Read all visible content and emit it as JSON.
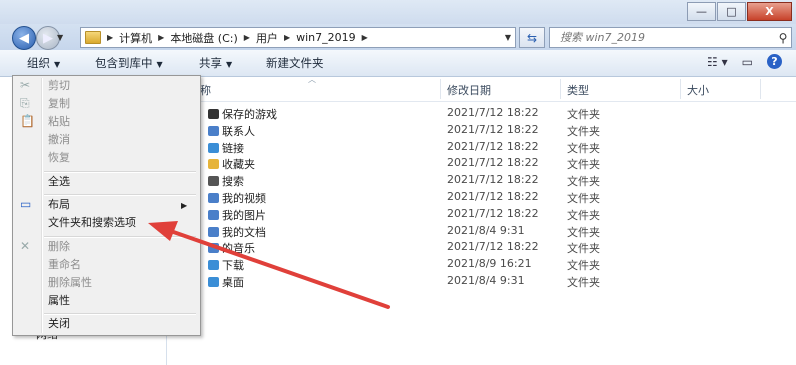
{
  "window": {
    "min": "—",
    "max": "□",
    "close": "X"
  },
  "address": {
    "crumbs": [
      "计算机",
      "本地磁盘 (C:)",
      "用户",
      "win7_2019"
    ]
  },
  "search": {
    "placeholder": "搜索 win7_2019"
  },
  "toolbar": {
    "organize": "组织",
    "include_library": "包含到库中",
    "share": "共享",
    "new_folder": "新建文件夹"
  },
  "columns": {
    "name": "称",
    "date": "修改日期",
    "type": "类型",
    "size": "大小"
  },
  "files": [
    {
      "name": "保存的游戏",
      "date": "2021/7/12 18:22",
      "type": "文件夹"
    },
    {
      "name": "联系人",
      "date": "2021/7/12 18:22",
      "type": "文件夹"
    },
    {
      "name": "链接",
      "date": "2021/7/12 18:22",
      "type": "文件夹"
    },
    {
      "name": "收藏夹",
      "date": "2021/7/12 18:22",
      "type": "文件夹"
    },
    {
      "name": "搜索",
      "date": "2021/7/12 18:22",
      "type": "文件夹"
    },
    {
      "name": "我的视频",
      "date": "2021/7/12 18:22",
      "type": "文件夹"
    },
    {
      "name": "我的图片",
      "date": "2021/7/12 18:22",
      "type": "文件夹"
    },
    {
      "name": "我的文档",
      "date": "2021/8/4 9:31",
      "type": "文件夹"
    },
    {
      "name": "的音乐",
      "date": "2021/7/12 18:22",
      "type": "文件夹"
    },
    {
      "name": "下载",
      "date": "2021/8/9 16:21",
      "type": "文件夹"
    },
    {
      "name": "桌面",
      "date": "2021/8/4 9:31",
      "type": "文件夹"
    }
  ],
  "menu": {
    "cut": "剪切",
    "copy": "复制",
    "paste": "粘贴",
    "undo": "撤消",
    "redo": "恢复",
    "select_all": "全选",
    "layout": "布局",
    "folder_options": "文件夹和搜索选项",
    "delete": "删除",
    "rename": "重命名",
    "remove_properties": "删除属性",
    "properties": "属性",
    "close": "关闭"
  },
  "sidebar": {
    "network": "网络"
  },
  "colors": {
    "arrow": "#e0403a",
    "accent": "#2a62c6"
  }
}
